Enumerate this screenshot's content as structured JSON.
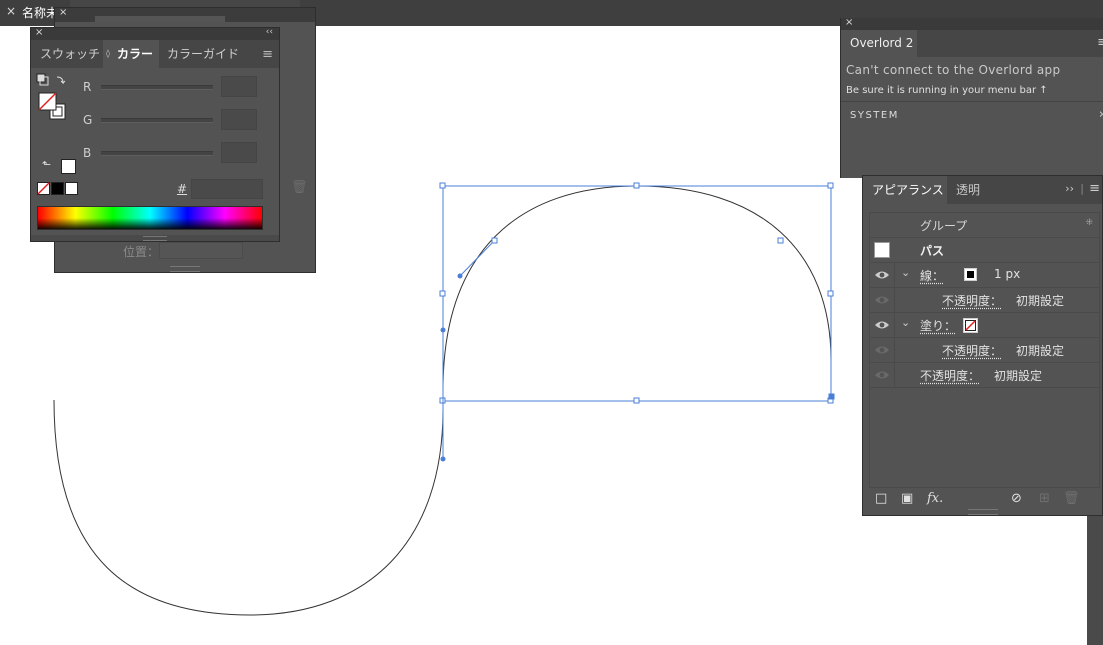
{
  "app": {
    "document_tab": "名称未",
    "close_glyph": "×"
  },
  "colors": {
    "panel_bg": "#535353",
    "tab_bar_bg": "#464646",
    "selection_blue": "#3d7bd8",
    "path_stroke": "#333333",
    "canvas": "#ffffff"
  },
  "position_panel": {
    "position_label": "位置："
  },
  "color_panel": {
    "tabs": [
      "スウォッチ",
      "カラー",
      "カラーガイド"
    ],
    "active_tab": "カラー",
    "sliders": [
      {
        "label": "R"
      },
      {
        "label": "G"
      },
      {
        "label": "B"
      }
    ],
    "hex_label": "#",
    "collapse_glyph": "‹‹",
    "menu_glyph": "≡"
  },
  "overlord_panel": {
    "tab": "Overlord 2",
    "message": "Can't connect to the Overlord app",
    "hint": "Be sure it is running in your menu bar ↑",
    "section": "SYSTEM",
    "chevron": "›",
    "menu_glyph": "≡"
  },
  "appearance_panel": {
    "tabs": [
      "アピアランス",
      "透明"
    ],
    "expand_glyph": "››",
    "menu_glyph": "≡",
    "rows": [
      {
        "name": "group-row",
        "text": "グループ"
      },
      {
        "name": "path-row",
        "text": "パス"
      },
      {
        "name": "stroke-row",
        "label": "線：",
        "value": "1 px"
      },
      {
        "name": "stroke-opacity-row",
        "label": "不透明度：",
        "value": "初期設定"
      },
      {
        "name": "fill-row",
        "label": "塗り："
      },
      {
        "name": "fill-opacity-row",
        "label": "不透明度：",
        "value": "初期設定"
      },
      {
        "name": "object-opacity-row",
        "label": "不透明度：",
        "value": "初期設定"
      }
    ],
    "footer_icons": [
      "add-stroke-icon",
      "add-fill-icon",
      "fx-icon",
      "clear-icon",
      "duplicate-icon",
      "trash-icon"
    ],
    "fx_label": "fx."
  }
}
